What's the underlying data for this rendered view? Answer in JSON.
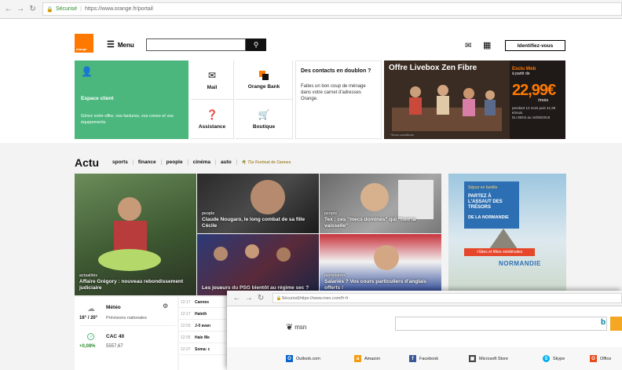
{
  "browser": {
    "secure_label": "Sécurisé",
    "url": "https://www.orange.fr/portail"
  },
  "header": {
    "logo_text": "orange",
    "menu_label": "Menu",
    "search_placeholder": "",
    "login_label": "Identifiez-vous"
  },
  "tiles": {
    "espace_client": {
      "title": "Espace client",
      "text": "Gérez votre offre, vos factures, vos conso et vos équipements"
    },
    "quick": [
      {
        "label": "Mail"
      },
      {
        "label": "Orange Bank"
      },
      {
        "label": "Assistance"
      },
      {
        "label": "Boutique"
      }
    ],
    "ad_contacts": {
      "heading": "Des contacts en doublon ?",
      "body": "Faites un bon coup de ménage dans votre carnet d'adresses Orange."
    },
    "livebox": {
      "title": "Offre Livebox Zen Fibre",
      "promo": "Exclu Web",
      "from": "à partir de",
      "price": "22,99€",
      "period": "/mois",
      "fine": "pendant 12 mois puis 41,99 €/mois",
      "dates": "Du 06/04 au 16/05/2018",
      "footer": "*Sous conditions"
    }
  },
  "actu": {
    "title": "Actu",
    "categories": [
      "sports",
      "finance",
      "people",
      "cinéma",
      "auto"
    ],
    "festival": "71e Festival de Cannes"
  },
  "news": [
    {
      "tag": "actualités",
      "title": "Affaire Grégory : nouveau rebondissement judiciaire"
    },
    {
      "tag": "people",
      "title": "Claude Nougaro, le long combat de sa fille Cécile"
    },
    {
      "tag": "people",
      "title": "Tex : ces \"mecs dominés\" qui \"font la vaisselle\""
    },
    {
      "tag": "",
      "title": "Les joueurs du PSG bientôt au régime sec ?"
    },
    {
      "tag": "partenaires",
      "title": "Salariés ? Vos cours particuliers d'anglais offerts !"
    }
  ],
  "normandie_ad": {
    "kicker": "Séjour en famille",
    "headline": "PARTEZ À L'ASSAUT DES TRÉSORS",
    "subline": "DE LA NORMANDIE",
    "cta": "Sites et fêtes médiévales",
    "brand": "NORMANDIE"
  },
  "weather": {
    "title": "Météo",
    "temps": "16° / 20°",
    "desc": "Prévisions nationales"
  },
  "market": {
    "title": "CAC 40",
    "change": "+0,08%",
    "value": "5557,67"
  },
  "feed": [
    {
      "time": "12:17",
      "text": "Cannes"
    },
    {
      "time": "12:17",
      "text": "Haleth"
    },
    {
      "time": "12:03",
      "text": "J-0 avan"
    },
    {
      "time": "12:05",
      "text": "Hale Me"
    },
    {
      "time": "12:27",
      "text": "Soma: c"
    }
  ],
  "msn": {
    "secure_label": "Sécurisé",
    "url": "https://www.msn.com/fr-fr",
    "logo": "msn",
    "links": [
      "Outlook.com",
      "Amazon",
      "Facebook",
      "Microsoft Store",
      "Skype",
      "Office"
    ]
  },
  "colors": {
    "orange": "#ff7900",
    "green": "#4bb77d"
  }
}
